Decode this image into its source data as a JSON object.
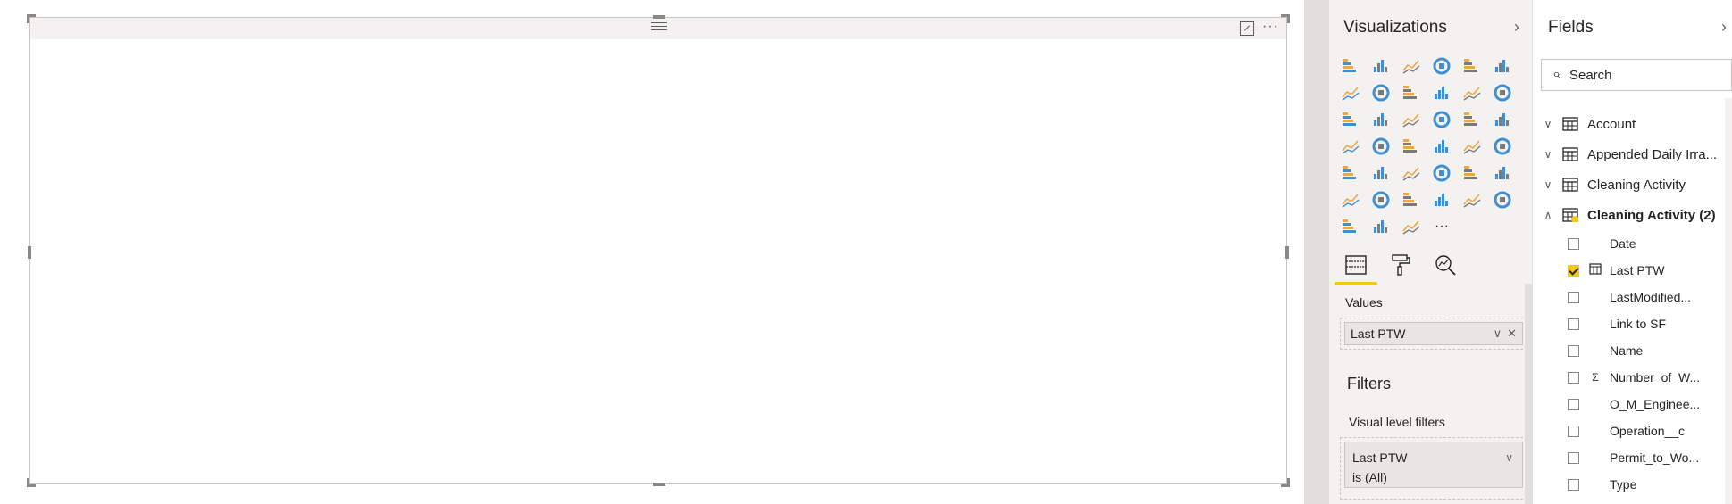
{
  "visualizations_pane": {
    "title": "Visualizations",
    "collapse_icon": "chevron-right-icon",
    "icons": [
      "stacked-bar-chart-icon",
      "stacked-column-chart-icon",
      "clustered-bar-chart-icon",
      "clustered-column-chart-icon",
      "100-stacked-bar-chart-icon",
      "100-stacked-column-chart-icon",
      "line-chart-icon",
      "area-chart-icon",
      "stacked-area-chart-icon",
      "line-and-stacked-column-chart-icon",
      "line-and-clustered-column-chart-icon",
      "ribbon-chart-icon",
      "waterfall-chart-icon",
      "scatter-chart-icon",
      "pie-chart-icon",
      "donut-chart-icon",
      "treemap-icon",
      "map-icon",
      "filled-map-icon",
      "funnel-icon",
      "gauge-icon",
      "card-icon",
      "multi-row-card-icon",
      "kpi-icon",
      "slicer-icon",
      "table-icon",
      "matrix-icon",
      "r-visual-icon",
      "python-visual-icon",
      "arcgis-map-icon",
      "key-influencers-icon",
      "qna-icon",
      "custom-number-icon",
      "sort-az-icon",
      "image-visual-icon",
      "monitor-visual-icon",
      "custom-waveform-icon",
      "custom-image-icon",
      "custom-grid-icon",
      "more-visuals-icon"
    ],
    "tabs": [
      "fields-tab",
      "format-tab",
      "analytics-tab"
    ],
    "values_label": "Values",
    "values_well": [
      {
        "label": "Last PTW"
      }
    ],
    "filters_title": "Filters",
    "visual_filters_label": "Visual level filters",
    "filter_cards": [
      {
        "field": "Last PTW",
        "condition": "is (All)"
      }
    ],
    "accent": "#f2c811"
  },
  "fields_pane": {
    "title": "Fields",
    "search_placeholder": "Search",
    "tables": [
      {
        "name": "Account",
        "expanded": false,
        "bold": false
      },
      {
        "name": "Appended Daily Irra...",
        "expanded": false,
        "bold": false
      },
      {
        "name": "Cleaning Activity",
        "expanded": false,
        "bold": false
      },
      {
        "name": "Cleaning Activity (2)",
        "expanded": true,
        "bold": true
      }
    ],
    "fields": [
      {
        "name": "Date",
        "checked": false,
        "type": ""
      },
      {
        "name": "Last PTW",
        "checked": true,
        "type": "calendar"
      },
      {
        "name": "LastModified...",
        "checked": false,
        "type": ""
      },
      {
        "name": "Link to SF",
        "checked": false,
        "type": ""
      },
      {
        "name": "Name",
        "checked": false,
        "type": ""
      },
      {
        "name": "Number_of_W...",
        "checked": false,
        "type": "Σ"
      },
      {
        "name": "O_M_Enginee...",
        "checked": false,
        "type": ""
      },
      {
        "name": "Operation__c",
        "checked": false,
        "type": ""
      },
      {
        "name": "Permit_to_Wo...",
        "checked": false,
        "type": ""
      },
      {
        "name": "Type",
        "checked": false,
        "type": ""
      }
    ]
  },
  "visual": {
    "more_options": "···"
  }
}
